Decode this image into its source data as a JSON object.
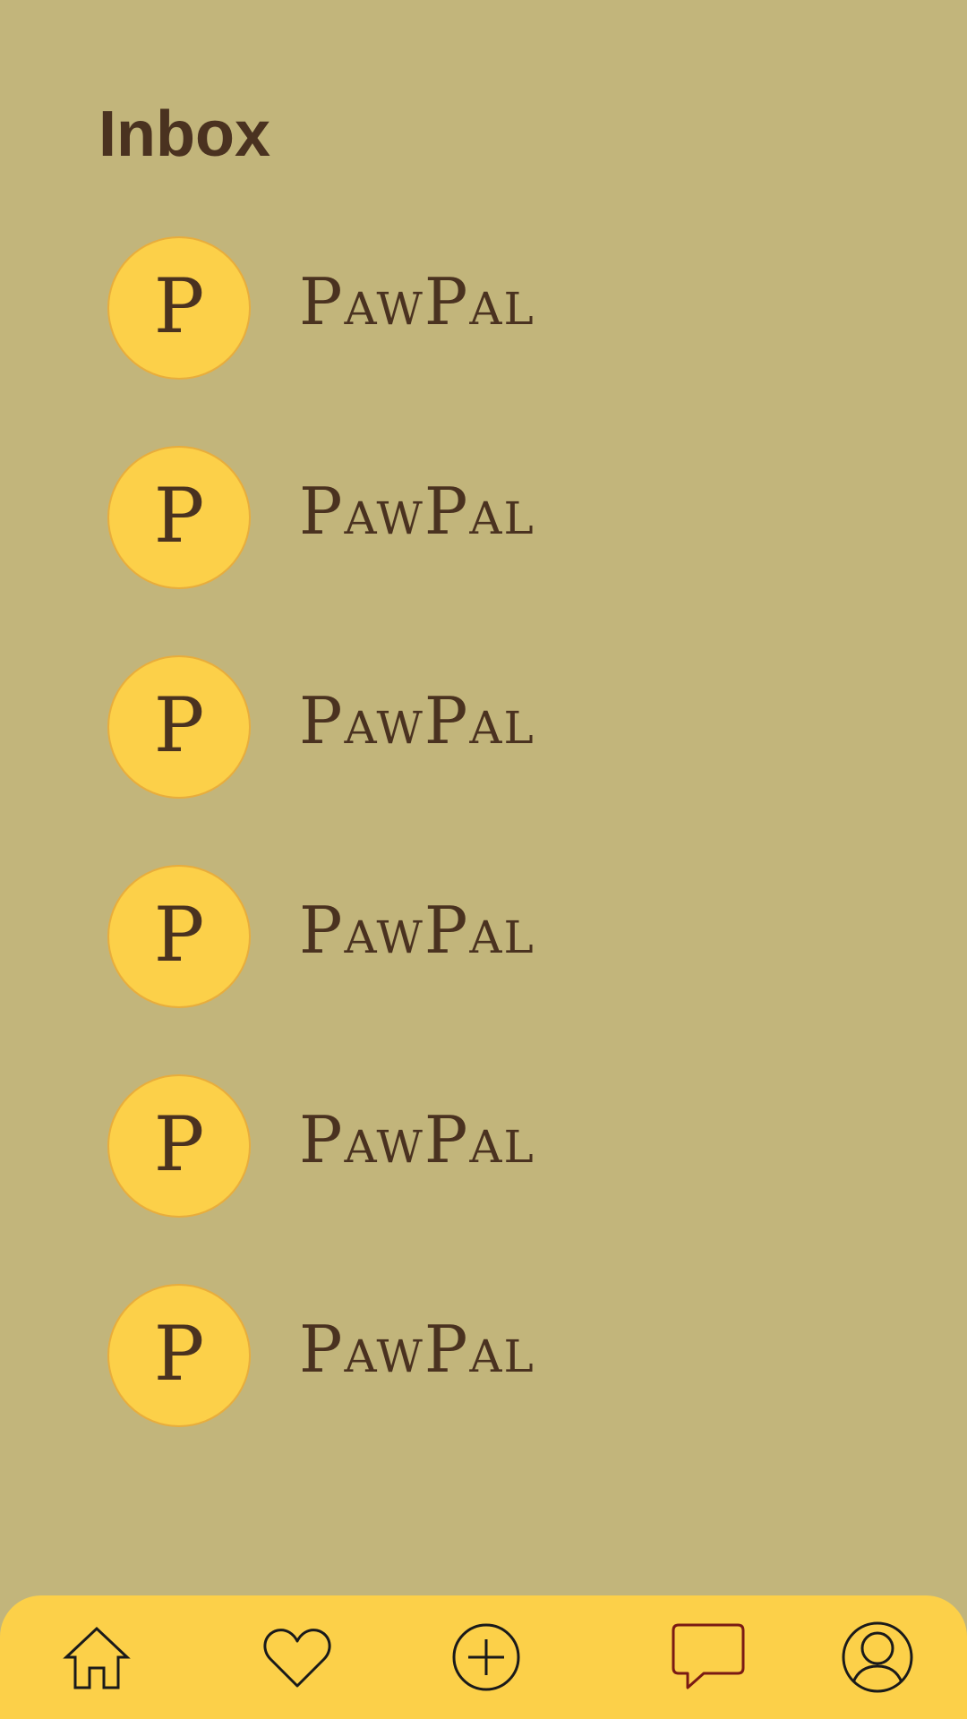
{
  "page": {
    "title": "Inbox"
  },
  "inbox": {
    "items": [
      {
        "avatar_letter": "P",
        "name": "PawPal"
      },
      {
        "avatar_letter": "P",
        "name": "PawPal"
      },
      {
        "avatar_letter": "P",
        "name": "PawPal"
      },
      {
        "avatar_letter": "P",
        "name": "PawPal"
      },
      {
        "avatar_letter": "P",
        "name": "PawPal"
      },
      {
        "avatar_letter": "P",
        "name": "PawPal"
      }
    ]
  },
  "bottom_nav": {
    "items": [
      {
        "icon": "home-icon"
      },
      {
        "icon": "heart-icon"
      },
      {
        "icon": "add-circle-icon"
      },
      {
        "icon": "chat-icon"
      },
      {
        "icon": "profile-icon"
      }
    ]
  },
  "colors": {
    "background": "#c2b57b",
    "accent": "#fcd049",
    "text": "#4a3220",
    "avatar_border": "#e8ad3c"
  }
}
